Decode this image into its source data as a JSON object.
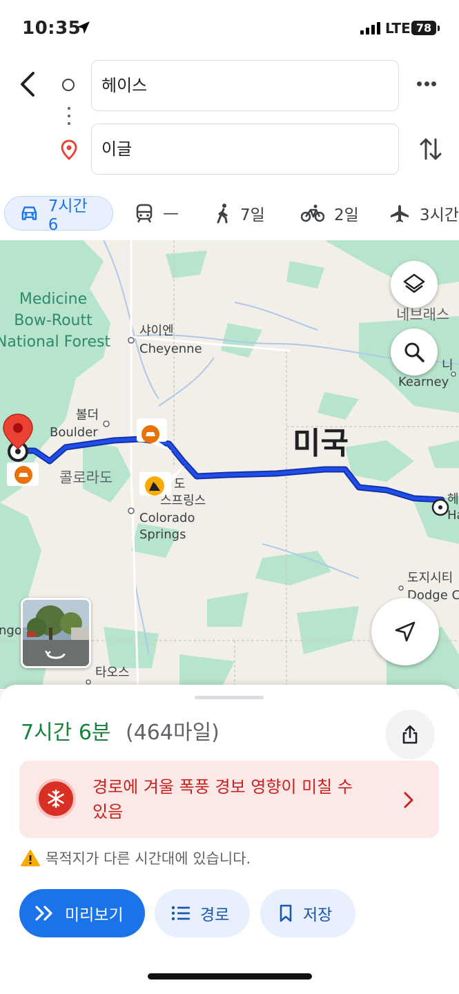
{
  "status_bar": {
    "time": "10:35",
    "network": "LTE",
    "battery": "78"
  },
  "search": {
    "origin": "헤이스",
    "destination": "이글"
  },
  "modes": [
    {
      "label": "7시간 6",
      "icon": "car-icon",
      "active": true
    },
    {
      "label": "—",
      "icon": "train-icon"
    },
    {
      "label": "7일",
      "icon": "walk-icon"
    },
    {
      "label": "2일",
      "icon": "bike-icon"
    },
    {
      "label": "3시간",
      "icon": "plane-icon"
    }
  ],
  "map": {
    "forest": "Medicine\nBow-Routt\nNational Forest",
    "cheyenne_ko": "샤이엔",
    "cheyenne": "Cheyenne",
    "nebraska_ko": "네브래스",
    "kearney_ko": "니",
    "kearney": "Kearney",
    "boulder_ko": "볼더",
    "boulder": "Boulder",
    "colorado_state": "콜로라도",
    "country": "미국",
    "springs_ko": "스프링스",
    "colorado_springs": "Colorado\nSprings",
    "hays_ko": "헤",
    "hays": "Ha",
    "dodge_ko": "도지시티",
    "dodge": "Dodge C",
    "left_edge": "ngo",
    "taos": "타오스",
    "colorado_short": "도"
  },
  "summary": {
    "duration": "7시간 6분",
    "distance": "(464마일)"
  },
  "alert": {
    "text": "경로에 겨울 폭풍 경보 영향이 미칠 수 있음"
  },
  "timezone_notice": "목적지가 다른 시간대에 있습니다.",
  "buttons": {
    "preview": "미리보기",
    "steps": "경로",
    "save": "저장"
  },
  "colors": {
    "route": "#1a3fd6",
    "accent": "#1a73e8",
    "duration": "#188038",
    "alert": "#c5221f",
    "pin": "#ea4335"
  }
}
